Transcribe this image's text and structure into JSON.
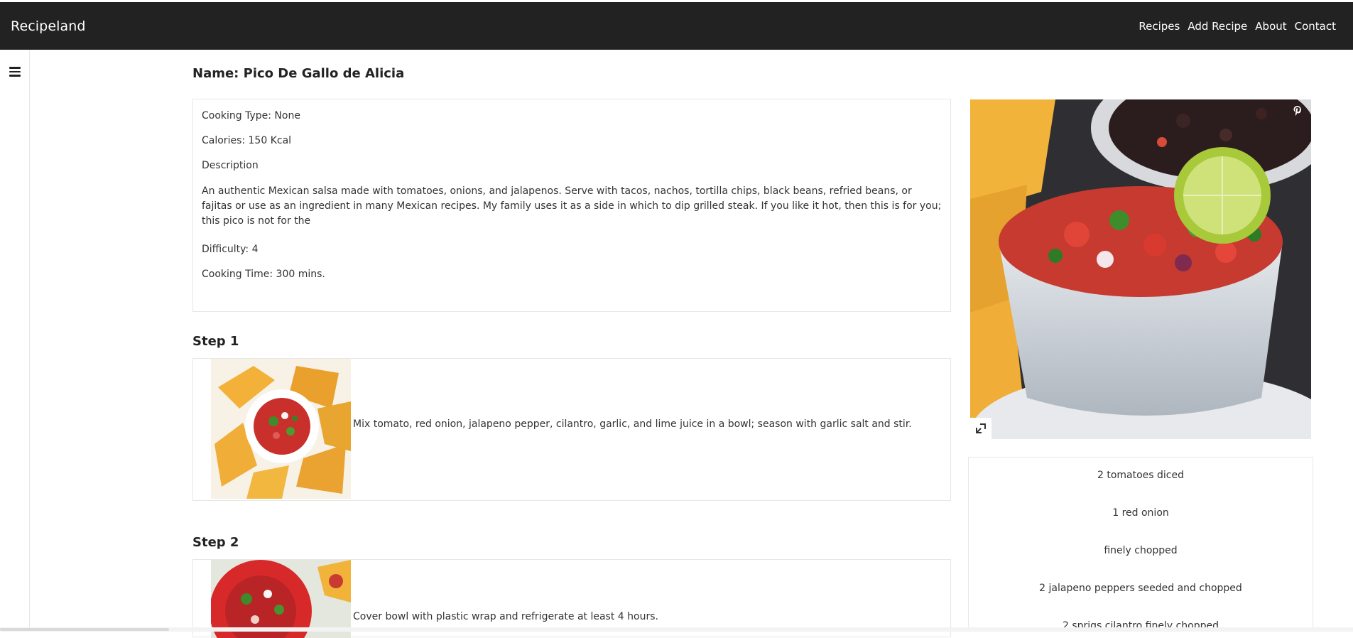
{
  "navbar": {
    "brand": "Recipeland",
    "links": [
      "Recipes",
      "Add Recipe",
      "About",
      "Contact"
    ]
  },
  "recipe": {
    "name": "Name: Pico De Gallo de Alicia",
    "cooking_type": "Cooking Type: None",
    "calories": "Calories: 150 Kcal",
    "description_label": "Description",
    "description": "An authentic Mexican salsa made with tomatoes, onions, and jalapenos. Serve with tacos, nachos, tortilla chips, black beans, refried beans, or fajitas or use as an ingredient in many Mexican recipes. My family uses it as a side in which to dip grilled steak. If you like it hot, then this is for you; this pico is not for the",
    "difficulty": "Difficulty: 4",
    "cooking_time": "Cooking Time: 300 mins."
  },
  "steps": [
    {
      "title": "Step 1",
      "text": "Mix tomato, red onion, jalapeno pepper, cilantro, garlic, and lime juice in a bowl; season with garlic salt and stir."
    },
    {
      "title": "Step 2",
      "text": "Cover bowl with plastic wrap and refrigerate at least 4 hours."
    }
  ],
  "ingredients": [
    "2 tomatoes diced",
    "1 red onion",
    "finely chopped",
    "2 jalapeno peppers seeded and chopped",
    "2 sprigs cilantro finely chopped"
  ],
  "icons": {
    "menu": "hamburger-icon",
    "pin": "pinterest-icon",
    "expand": "expand-icon"
  },
  "colors": {
    "navbar_bg": "#222222",
    "text": "#333333",
    "border": "#e7e7e7"
  }
}
